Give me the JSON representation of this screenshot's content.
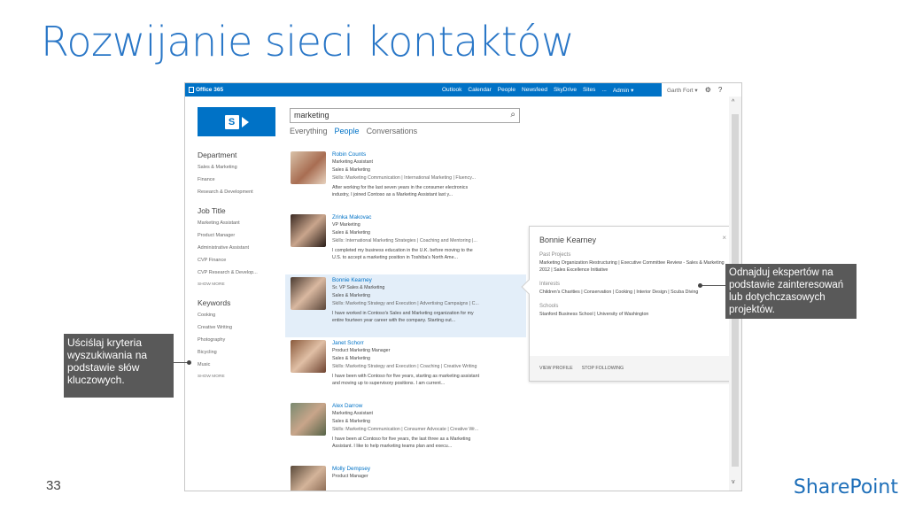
{
  "slide": {
    "title": "Rozwijanie sieci kontaktów",
    "number": "33",
    "brand": "SharePoint",
    "callout_left": "Uściślaj kryteria wyszukiwania na podstawie słów kluczowych.",
    "callout_right": "Odnajduj ekspertów na podstawie zainteresowań lub dotychczasowych projektów."
  },
  "suitebar": {
    "app_name": "Office 365",
    "links": [
      "Outlook",
      "Calendar",
      "People",
      "Newsfeed",
      "SkyDrive",
      "Sites",
      "...",
      "Admin ▾"
    ],
    "user": "Garth Fort ▾",
    "settings_icon": "gear-icon",
    "help_label": "?"
  },
  "search": {
    "query": "marketing",
    "tabs": [
      "Everything",
      "People",
      "Conversations"
    ],
    "active_tab": "People"
  },
  "refiners": {
    "department": {
      "heading": "Department",
      "items": [
        "Sales & Marketing",
        "Finance",
        "Research & Development"
      ]
    },
    "job_title": {
      "heading": "Job Title",
      "items": [
        "Marketing Assistant",
        "Product Manager",
        "Administrative Assistant",
        "CVP Finance",
        "CVP Research & Develop..."
      ],
      "more": "SHOW MORE"
    },
    "keywords": {
      "heading": "Keywords",
      "items": [
        "Cooking",
        "Creative Writing",
        "Photography",
        "Bicycling",
        "Music"
      ],
      "more": "SHOW MORE"
    }
  },
  "results": [
    {
      "name": "Robin Counts",
      "title": "Marketing Assistant",
      "department": "Sales & Marketing",
      "skills": "Skills: Marketing Communication | International Marketing | Fluency...",
      "summary1": "After working for the last seven years in the consumer electronics",
      "summary2": "industry, I joined Contoso as a Marketing Assistant last y..."
    },
    {
      "name": "Zrinka Makovac",
      "title": "VP Marketing",
      "department": "Sales & Marketing",
      "skills": "Skills: International Marketing Strategies | Coaching and Mentoring |...",
      "summary1": "I completed my business education in the U.K. before moving to the",
      "summary2": "U.S. to accept a marketing position in Toshiba's North Ame..."
    },
    {
      "name": "Bonnie Kearney",
      "title": "Sr. VP Sales & Marketing",
      "department": "Sales & Marketing",
      "skills": "Skills: Marketing Strategy and Execution | Advertising Campaigns | C...",
      "summary1": "I have worked in Contoso's Sales and Marketing organization for my",
      "summary2": "entire fourteen year career with the company. Starting out..."
    },
    {
      "name": "Janet Schorr",
      "title": "Product Marketing Manager",
      "department": "Sales & Marketing",
      "skills": "Skills: Marketing Strategy and Execution | Coaching | Creative Writing",
      "summary1": "I have been with Contoso for five years, starting as marketing assistant",
      "summary2": "and moving up to supervisory positions. I am current..."
    },
    {
      "name": "Alex Darrow",
      "title": "Marketing Assistant",
      "department": "Sales & Marketing",
      "skills": "Skills: Marketing Communication | Consumer Advocate | Creative Wr...",
      "summary1": "I have been at Contoso for five years, the last three as a Marketing",
      "summary2": "Assistant. I like to help marketing teams plan and execu..."
    },
    {
      "name": "Molly Dempsey",
      "title": "Product Manager",
      "department": "",
      "skills": "",
      "summary1": "",
      "summary2": ""
    }
  ],
  "hovercard": {
    "name": "Bonnie Kearney",
    "close": "×",
    "past_projects_label": "Past Projects",
    "past_projects": "Marketing Organization Restructuring | Executive Committee Review - Sales & Marketing 2012 | Sales Excellence Initiative",
    "interests_label": "Interests",
    "interests": "Children's Charities | Conservation | Cooking | Interior Design | Scuba Diving",
    "schools_label": "Schools",
    "schools": "Stanford Business School | University of Washington",
    "view_profile": "VIEW PROFILE",
    "stop_following": "STOP FOLLOWING"
  },
  "colors": {
    "accent": "#0072c6",
    "title": "#2a77c7",
    "callout": "#595959",
    "highlight_row": "#e3eef9"
  }
}
